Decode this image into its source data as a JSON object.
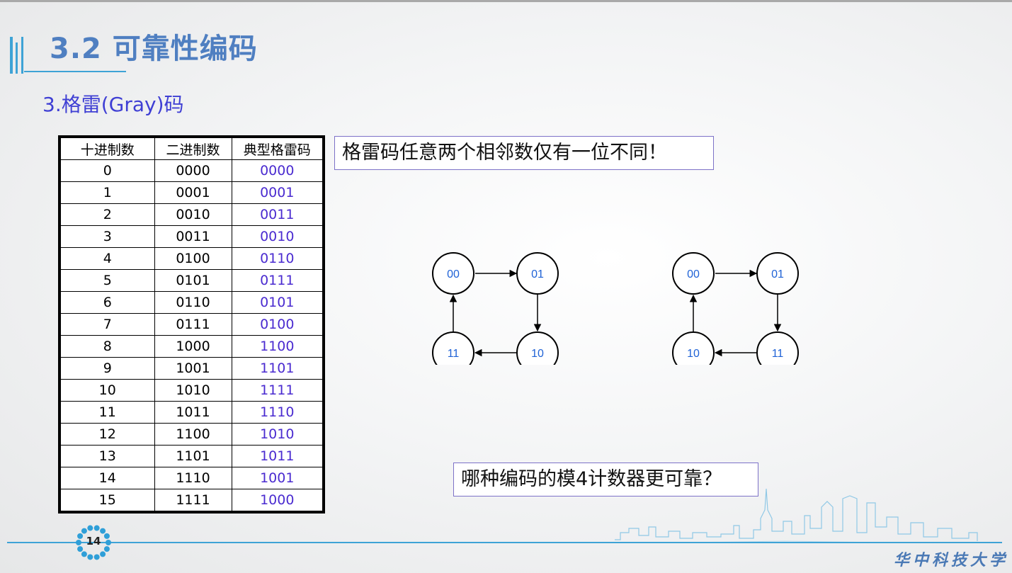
{
  "title": "3.2 可靠性编码",
  "subtitle": "3.格雷(Gray)码",
  "table": {
    "headers": [
      "十进制数",
      "二进制数",
      "典型格雷码"
    ],
    "rows": [
      [
        "0",
        "0000",
        "0000"
      ],
      [
        "1",
        "0001",
        "0001"
      ],
      [
        "2",
        "0010",
        "0011"
      ],
      [
        "3",
        "0011",
        "0010"
      ],
      [
        "4",
        "0100",
        "0110"
      ],
      [
        "5",
        "0101",
        "0111"
      ],
      [
        "6",
        "0110",
        "0101"
      ],
      [
        "7",
        "0111",
        "0100"
      ],
      [
        "8",
        "1000",
        "1100"
      ],
      [
        "9",
        "1001",
        "1101"
      ],
      [
        "10",
        "1010",
        "1111"
      ],
      [
        "11",
        "1011",
        "1110"
      ],
      [
        "12",
        "1100",
        "1010"
      ],
      [
        "13",
        "1101",
        "1011"
      ],
      [
        "14",
        "1110",
        "1001"
      ],
      [
        "15",
        "1111",
        "1000"
      ]
    ]
  },
  "note_top": "格雷码任意两个相邻数仅有一位不同！",
  "note_bottom": "哪种编码的模4计数器更可靠？",
  "diagram_left": {
    "top_left": "00",
    "top_right": "01",
    "bottom_right": "10",
    "bottom_left": "11"
  },
  "diagram_right": {
    "top_left": "00",
    "top_right": "01",
    "bottom_right": "11",
    "bottom_left": "10"
  },
  "page_number": "14",
  "logo": "华中科技大学",
  "colors": {
    "title": "#4f7fc1",
    "subtitle": "#3f3fd4",
    "gray_code": "#4a2bd0",
    "node_label": "#1f62d6",
    "rule": "#3ea3d6"
  }
}
